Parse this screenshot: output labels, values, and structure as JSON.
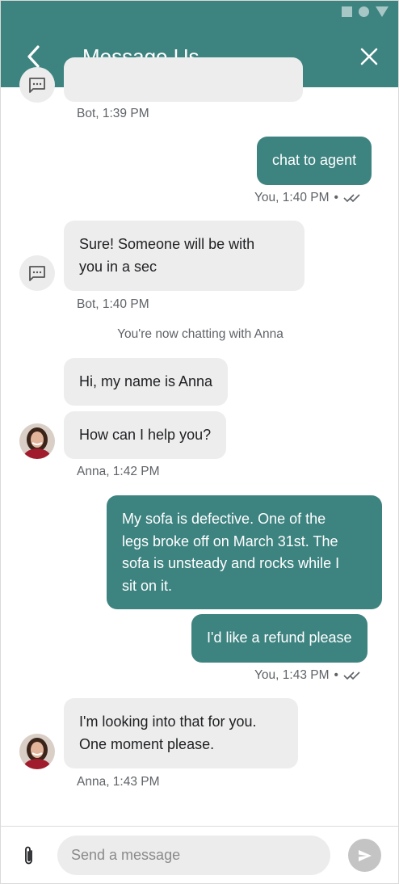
{
  "header": {
    "title": "Message Us",
    "accent": "#3d8380"
  },
  "messages": {
    "m0": {
      "meta": "Bot, 1:39 PM"
    },
    "m1": {
      "text": "chat to agent",
      "meta": "You, 1:40 PM"
    },
    "m2": {
      "line1": "Sure! Someone will be with",
      "line2": "you in a sec",
      "meta": "Bot, 1:40 PM"
    },
    "system": "You're now chatting with Anna",
    "m3": {
      "text": "Hi, my name is Anna"
    },
    "m4": {
      "text": "How can I help you?",
      "meta": "Anna, 1:42 PM"
    },
    "m5": {
      "line1": "My sofa is defective. One of the",
      "line2": "legs broke off on March 31st. The",
      "line3": "sofa is unsteady and rocks while I",
      "line4": "sit on it."
    },
    "m6": {
      "text": "I'd like a refund please",
      "meta": "You, 1:43 PM"
    },
    "m7": {
      "line1": "I'm looking into that for you.",
      "line2": "One moment please.",
      "meta": "Anna, 1:43 PM"
    }
  },
  "separator": "•",
  "composer": {
    "placeholder": "Send a message"
  },
  "icons": [
    "back-arrow-icon",
    "close-icon",
    "bot-chat-icon",
    "read-receipt-icon",
    "paperclip-icon",
    "send-icon"
  ]
}
